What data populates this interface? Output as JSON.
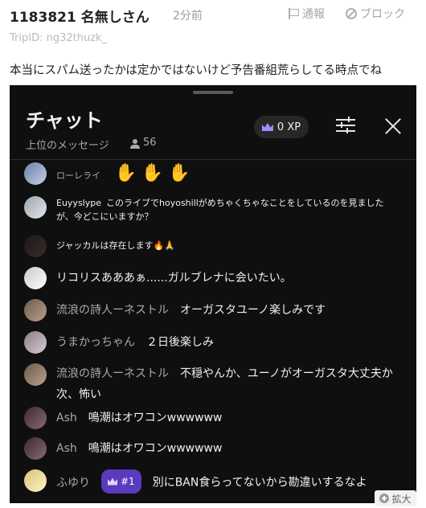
{
  "post": {
    "number": "1183821",
    "name": "名無しさん",
    "time": "2分前",
    "report_label": "通報",
    "block_label": "ブロック",
    "trip_id": "TripID: ng32thuzk_",
    "body": "本当にスパム送ったかは定かではないけど予告番組荒らしてる時点でね",
    "expand_label": "拡大"
  },
  "chat": {
    "title": "チャット",
    "filter_label": "上位のメッセージ",
    "viewer_count": "56",
    "xp_label": "0 XP",
    "messages": [
      {
        "author": "ローレライ",
        "text": "",
        "hands": [
          "✋",
          "✋",
          "✋"
        ]
      },
      {
        "author": "Euyyslype",
        "text": "このライブでhoyoshillがめちゃくちゃなことをしているのを見ましたが、今どこにいますか？"
      },
      {
        "author": "",
        "text": "ジャッカルは存在します🔥🙏"
      },
      {
        "author": "",
        "text": "リコリスあああぁ......ガルブレナに会いたい。"
      },
      {
        "author": "流浪の詩人ーネストル",
        "text": "オーガスタユーノ楽しみです"
      },
      {
        "author": "うまかっちゃん",
        "text": "２日後楽しみ"
      },
      {
        "author": "流浪の詩人ーネストル",
        "text": "不穏やんか、ユーノがオーガスタ大丈夫か次、怖い"
      },
      {
        "author": "Ash",
        "text": "鳴潮はオワコンwwwwww"
      },
      {
        "author": "Ash",
        "text": "鳴潮はオワコンwwwwww"
      },
      {
        "author": "ふゆり",
        "badge": "#1",
        "text": "別にBAN食らってないから勘違いするなよ"
      }
    ]
  },
  "colors": {
    "chat_bg": "#0f0f0f",
    "badge_purple": "#5a3bbd",
    "hand_pink": "#e8759a"
  },
  "icons": [
    "flag-icon",
    "block-icon",
    "crown-icon",
    "viewer-icon",
    "tune-icon",
    "close-icon",
    "plus-icon"
  ]
}
